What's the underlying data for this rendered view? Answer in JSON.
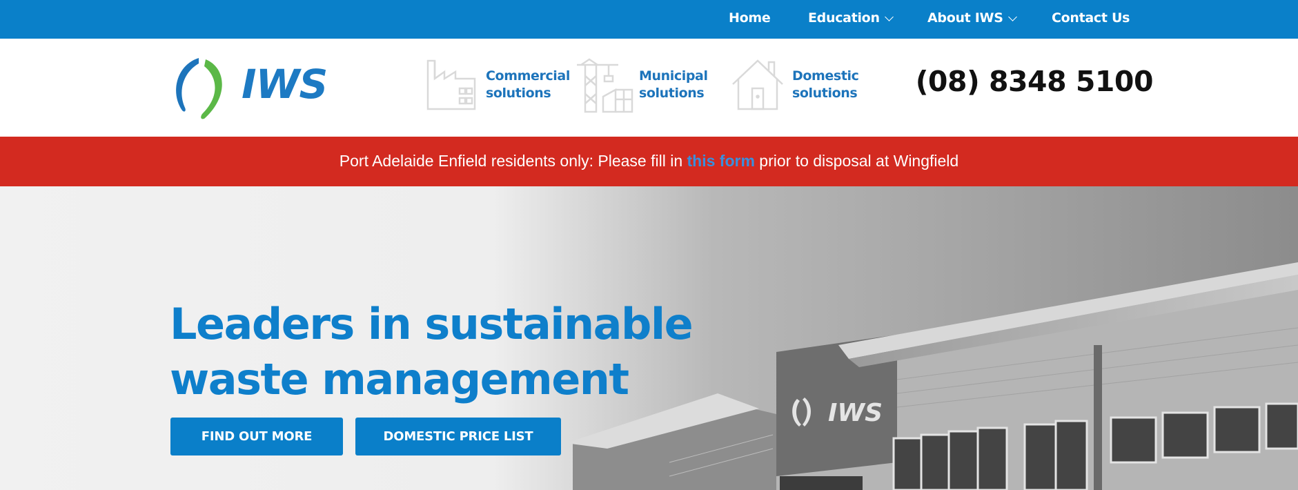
{
  "nav": {
    "items": [
      {
        "label": "Home",
        "has_dropdown": false
      },
      {
        "label": "Education",
        "has_dropdown": true
      },
      {
        "label": "About IWS",
        "has_dropdown": true
      },
      {
        "label": "Contact Us",
        "has_dropdown": false
      }
    ]
  },
  "header": {
    "logo_text": "IWS",
    "solutions": [
      {
        "line1": "Commercial",
        "line2": "solutions",
        "icon": "factory-icon"
      },
      {
        "line1": "Municipal",
        "line2": "solutions",
        "icon": "crane-icon"
      },
      {
        "line1": "Domestic",
        "line2": "solutions",
        "icon": "house-icon"
      }
    ],
    "phone": "(08) 8348 5100"
  },
  "alert": {
    "before": "Port Adelaide Enfield residents only: Please fill in ",
    "link": "this form",
    "after": " prior to disposal at Wingfield"
  },
  "hero": {
    "title_line1": "Leaders in sustainable",
    "title_line2": "waste management",
    "buttons": {
      "find_out_more": "FIND OUT MORE",
      "price_list": "DOMESTIC PRICE LIST"
    },
    "building_sign": "IWS"
  },
  "colors": {
    "nav_bg": "#0a80c9",
    "alert_bg": "#d32a20",
    "accent_blue": "#0e7fcb",
    "logo_green": "#5bb847"
  }
}
